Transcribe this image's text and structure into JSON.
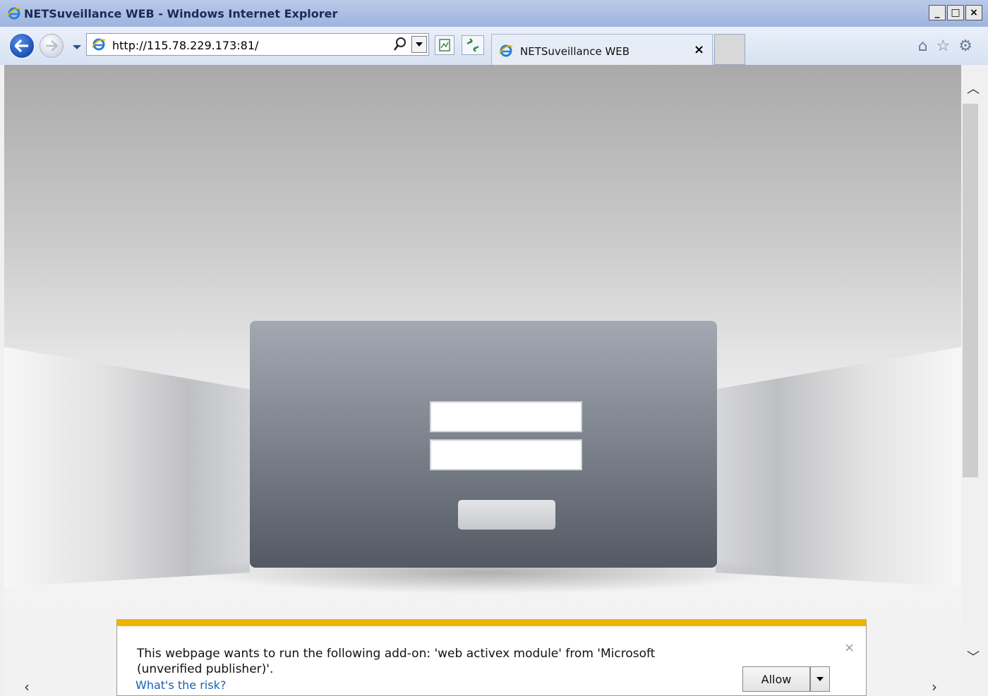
{
  "window": {
    "title": "NETSuveillance WEB - Windows Internet Explorer",
    "controls": {
      "minimize": "_",
      "maximize": "□",
      "close": "×"
    }
  },
  "address_bar": {
    "url": "http://115.78.229.173:81/"
  },
  "tab": {
    "label": "NETSuveillance WEB",
    "close": "×"
  },
  "toolbar_icons": [
    "home-icon",
    "star-icon",
    "gear-icon"
  ],
  "login": {
    "username_value": "",
    "password_value": ""
  },
  "infobar": {
    "message": "This webpage wants to run the following add-on: 'web activex  module' from 'Microsoft (unverified publisher)'.",
    "risk_link": "What's the risk?",
    "allow_label": "Allow",
    "close": "×",
    "accent_color": "#f0b400"
  }
}
